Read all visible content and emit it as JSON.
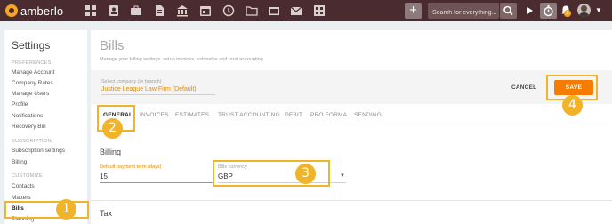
{
  "app": {
    "name": "amberlo"
  },
  "topbar": {
    "nav_icons": [
      "dashboard-icon",
      "contacts-icon",
      "briefcase-icon",
      "document-icon",
      "bank-icon",
      "calendar-icon",
      "history-icon",
      "folder-icon",
      "files-icon",
      "mail-icon",
      "grid-icon"
    ],
    "add_label": "+",
    "search_placeholder": "Search for everything...",
    "bell_badge": "3"
  },
  "sidebar": {
    "title": "Settings",
    "sections": {
      "preferences": "PREFERENCES",
      "subscription": "SUBSCRIPTION",
      "customize": "CUSTOMIZE"
    },
    "items": {
      "manage_account": "Manage Account",
      "company_rates": "Company Rates",
      "manage_users": "Manage Users",
      "profile": "Profile",
      "notifications": "Notifications",
      "recovery_bin": "Recovery Bin",
      "subscription_settings": "Subscription settings",
      "billing": "Billing",
      "contacts": "Contacts",
      "matters": "Matters",
      "bills": "Bills",
      "planning": "Planning"
    }
  },
  "main": {
    "title": "Bills",
    "subtitle": "Manage your billing settings, setup invoices, estimates and trust accounting",
    "company": {
      "label": "Select company (or branch)",
      "value": "Justice League Law Firm (Default)"
    },
    "cancel_label": "CANCEL",
    "save_label": "SAVE",
    "tabs": [
      "GENERAL",
      "INVOICES",
      "ESTIMATES",
      "TRUST ACCOUNTING",
      "DEBIT",
      "PRO FORMA",
      "SENDING"
    ],
    "billing": {
      "heading": "Billing",
      "term_label": "Default payment term (days)",
      "term_value": "15",
      "currency_label": "Bills currency",
      "currency_value": "GBP"
    },
    "tax_heading": "Tax"
  },
  "callouts": [
    "1",
    "2",
    "3",
    "4"
  ],
  "colors": {
    "topbar": "#4a2b2f",
    "accent_orange": "#f57c00",
    "callout_yellow": "#f0b42a"
  }
}
